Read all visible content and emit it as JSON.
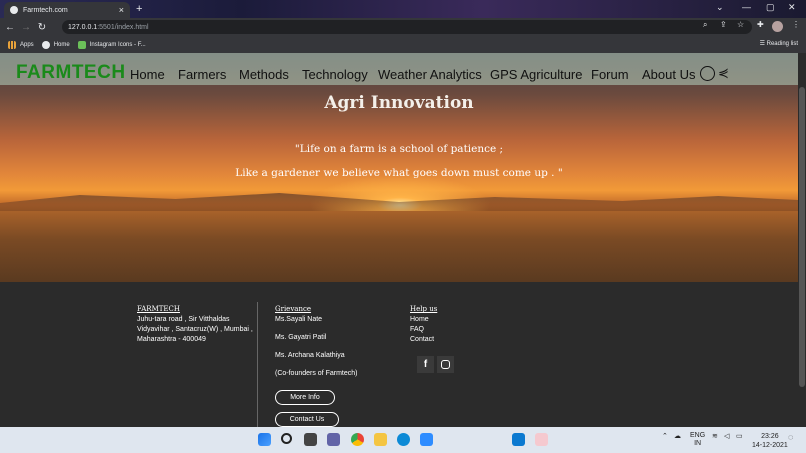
{
  "browser": {
    "tab_title": "Farmtech.com",
    "new_tab": "+",
    "url_host": "127.0.0.1",
    "url_path": ":5501/index.html",
    "bookmarks": [
      "Apps",
      "Home",
      "Instagram Icons - F..."
    ],
    "reading_list": "Reading list"
  },
  "site": {
    "logo": "FARMTECH",
    "nav": [
      "Home",
      "Farmers",
      "Methods",
      "Technology",
      "Weather Analytics",
      "GPS Agriculture",
      "Forum",
      "About Us"
    ],
    "hero_title": "Agri Innovation",
    "quote_line1": "\"Life on a farm is a school of patience ;",
    "quote_line2": "Like a gardener we believe what goes down must come up . \""
  },
  "footer": {
    "address_heading": "FARMTECH",
    "address_lines": [
      "Juhu-tara road , Sir Vitthaldas",
      "Vidyavihar , Santacruz(W) , Mumbai ,",
      "Maharashtra - 400049"
    ],
    "grievance_heading": "Grievance",
    "grievance_lines": [
      "Ms.Sayali Nate",
      "Ms. Gayatri Patil",
      "Ms. Archana Kalathiya",
      "(Co-founders of Farmtech)"
    ],
    "more_info": "More Info",
    "contact_us": "Contact Us",
    "help_heading": "Help us",
    "help_links": [
      "Home",
      "FAQ",
      "Contact"
    ],
    "social": [
      "f",
      "instagram-icon"
    ]
  },
  "taskbar": {
    "lang_top": "ENG",
    "lang_bottom": "IN",
    "time": "23:26",
    "date": "14-12-2021"
  },
  "colors": {
    "logo": "#1a8a1a",
    "footer_bg": "#2b2b2b"
  }
}
